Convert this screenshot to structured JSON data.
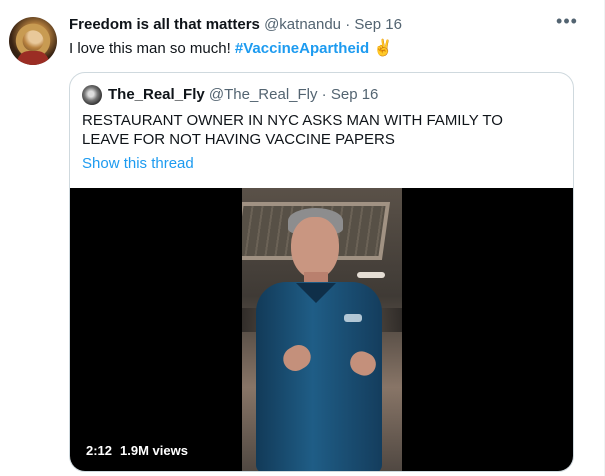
{
  "tweet": {
    "display_name": "Freedom is all that matters",
    "handle": "@katnandu",
    "separator": "·",
    "date": "Sep 16",
    "text_prefix": "I love this man so much! ",
    "hashtag": "#VaccineApartheid",
    "emoji": "✌"
  },
  "quoted_tweet": {
    "display_name": "The_Real_Fly",
    "handle": "@The_Real_Fly",
    "separator": "·",
    "date": "Sep 16",
    "text": "RESTAURANT OWNER IN NYC ASKS MAN WITH FAMILY TO LEAVE FOR NOT HAVING VACCINE PAPERS",
    "thread_link": "Show this thread"
  },
  "video": {
    "duration": "2:12",
    "views": "1.9M views"
  },
  "icons": {
    "more": "more-options-icon",
    "emoji": "victory-hand-icon"
  },
  "colors": {
    "link": "#1d9bf0",
    "secondary_text": "#536471",
    "border": "#cfd9de"
  }
}
